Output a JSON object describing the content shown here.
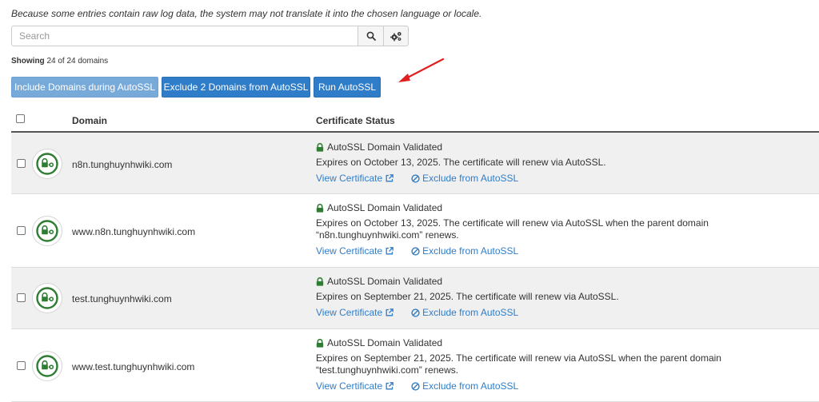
{
  "notice": "Because some entries contain raw log data, the system may not translate it into the chosen language or locale.",
  "search": {
    "placeholder": "Search",
    "value": ""
  },
  "icons": {
    "search": "search-icon",
    "settings": "gears-icon",
    "arrow": "red-arrow-annotation",
    "lock": "lock-icon"
  },
  "showing": {
    "label": "Showing",
    "text": "24 of 24 domains"
  },
  "actions": {
    "include_label": "Include Domains during AutoSSL",
    "exclude_label": "Exclude 2 Domains from AutoSSL",
    "run_label": "Run AutoSSL"
  },
  "table": {
    "headers": {
      "domain": "Domain",
      "status": "Certificate Status"
    },
    "rows": [
      {
        "domain": "n8n.tunghuynhwiki.com",
        "status": "AutoSSL Domain Validated",
        "expires": "Expires on October 13, 2025. The certificate will renew via AutoSSL.",
        "view": "View Certificate",
        "exclude": "Exclude from AutoSSL"
      },
      {
        "domain": "www.n8n.tunghuynhwiki.com",
        "status": "AutoSSL Domain Validated",
        "expires": "Expires on October 13, 2025. The certificate will renew via AutoSSL when the parent domain “n8n.tunghuynhwiki.com” renews.",
        "view": "View Certificate",
        "exclude": "Exclude from AutoSSL"
      },
      {
        "domain": "test.tunghuynhwiki.com",
        "status": "AutoSSL Domain Validated",
        "expires": "Expires on September 21, 2025. The certificate will renew via AutoSSL.",
        "view": "View Certificate",
        "exclude": "Exclude from AutoSSL"
      },
      {
        "domain": "www.test.tunghuynhwiki.com",
        "status": "AutoSSL Domain Validated",
        "expires": "Expires on September 21, 2025. The certificate will renew via AutoSSL when the parent domain “test.tunghuynhwiki.com” renews.",
        "view": "View Certificate",
        "exclude": "Exclude from AutoSSL"
      }
    ]
  },
  "colors": {
    "accent": "#2f7dc8",
    "success": "#2e7d32",
    "annotation": "#e02020",
    "row_shade": "#f0f0f0"
  }
}
